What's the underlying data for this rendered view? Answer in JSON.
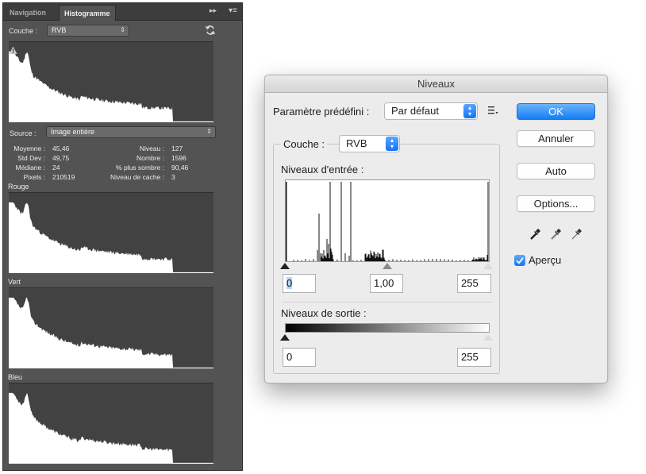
{
  "panel": {
    "tabs": [
      "Navigation",
      "Histogramme"
    ],
    "active_tab": "Histogramme",
    "channel_label": "Couche :",
    "channel_value": "RVB",
    "source_label": "Source :",
    "source_value": "Image entière",
    "stats": {
      "moyenne_label": "Moyenne :",
      "moyenne": "45,46",
      "stddev_label": "Std Dev :",
      "stddev": "49,75",
      "mediane_label": "Médiane :",
      "mediane": "24",
      "pixels_label": "Pixels :",
      "pixels": "210519",
      "niveau_label": "Niveau :",
      "niveau": "127",
      "nombre_label": "Nombre :",
      "nombre": "1596",
      "pct_label": "% plus sombre :",
      "pct": "90,46",
      "cache_label": "Niveau de cache :",
      "cache": "3"
    },
    "channels": [
      "Rouge",
      "Vert",
      "Bleu"
    ]
  },
  "dialog": {
    "title": "Niveaux",
    "preset_label": "Paramètre prédéfini :",
    "preset_value": "Par défaut",
    "channel_label": "Couche :",
    "channel_value": "RVB",
    "input_label": "Niveaux d'entrée :",
    "input_black": "0",
    "input_gamma": "1,00",
    "input_white": "255",
    "output_label": "Niveaux de sortie :",
    "output_black": "0",
    "output_white": "255",
    "buttons": {
      "ok": "OK",
      "cancel": "Annuler",
      "auto": "Auto",
      "options": "Options..."
    },
    "preview_label": "Aperçu",
    "preview_checked": true
  },
  "colors": {
    "panel_bg": "#535353",
    "histogram_bg": "#424242",
    "accent_blue": "#167ef6"
  },
  "icons": [
    "refresh-icon",
    "warning-icon",
    "preset-options-icon",
    "black-eyedropper-icon",
    "gray-eyedropper-icon",
    "white-eyedropper-icon",
    "checkmark-icon"
  ]
}
